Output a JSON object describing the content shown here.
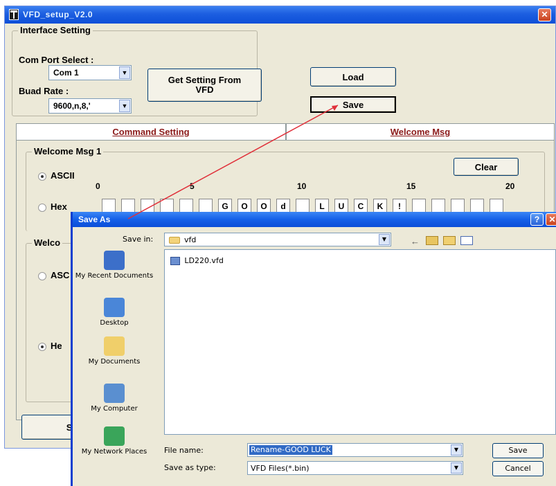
{
  "main_window": {
    "title": "VFD_setup_V2.0",
    "close_glyph": "✕"
  },
  "interface": {
    "legend": "Interface Setting",
    "com_port_label": "Com Port Select :",
    "com_port_value": "Com 1",
    "baud_label": "Buad Rate :",
    "baud_value": "9600,n,8,'",
    "get_setting_line1": "Get Setting From",
    "get_setting_line2": "VFD",
    "load_label": "Load",
    "save_label": "Save"
  },
  "tabs": {
    "command": "Command Setting",
    "welcome": "Welcome Msg"
  },
  "welcome_msg1": {
    "legend": "Welcome Msg 1",
    "ascii_label": "ASCII",
    "hex_label": "Hex",
    "clear_label": "Clear",
    "ticks": [
      "0",
      "5",
      "10",
      "15",
      "20"
    ],
    "cells": [
      "",
      "",
      "",
      "",
      "",
      "",
      "G",
      "O",
      "O",
      "d",
      "",
      "L",
      "U",
      "C",
      "K",
      "!",
      "",
      "",
      "",
      "",
      ""
    ]
  },
  "welcome_msg2": {
    "legend": "Welco",
    "ascii_label": "ASC",
    "hex_label": "He"
  },
  "bottom_button_label": "Set",
  "save_as": {
    "title": "Save As",
    "help_glyph": "?",
    "close_glyph": "✕",
    "save_in_label": "Save in:",
    "save_in_value": "vfd",
    "places": [
      {
        "label": "My Recent Documents",
        "icon": "recent-docs-icon"
      },
      {
        "label": "Desktop",
        "icon": "desktop-icon"
      },
      {
        "label": "My Documents",
        "icon": "my-documents-icon"
      },
      {
        "label": "My Computer",
        "icon": "my-computer-icon"
      },
      {
        "label": "My Network Places",
        "icon": "network-places-icon"
      }
    ],
    "files": [
      "LD220.vfd"
    ],
    "file_name_label": "File name:",
    "file_name_value": "Rename-GOOD LUCK",
    "save_type_label": "Save as type:",
    "save_type_value": "VFD Files(*.bin)",
    "save_button": "Save",
    "cancel_button": "Cancel"
  },
  "colors": {
    "title_blue": "#0d4fd8",
    "tab_text": "#8b1a1a",
    "annotation_arrow": "#e0303a",
    "window_bg": "#ece9d8"
  }
}
